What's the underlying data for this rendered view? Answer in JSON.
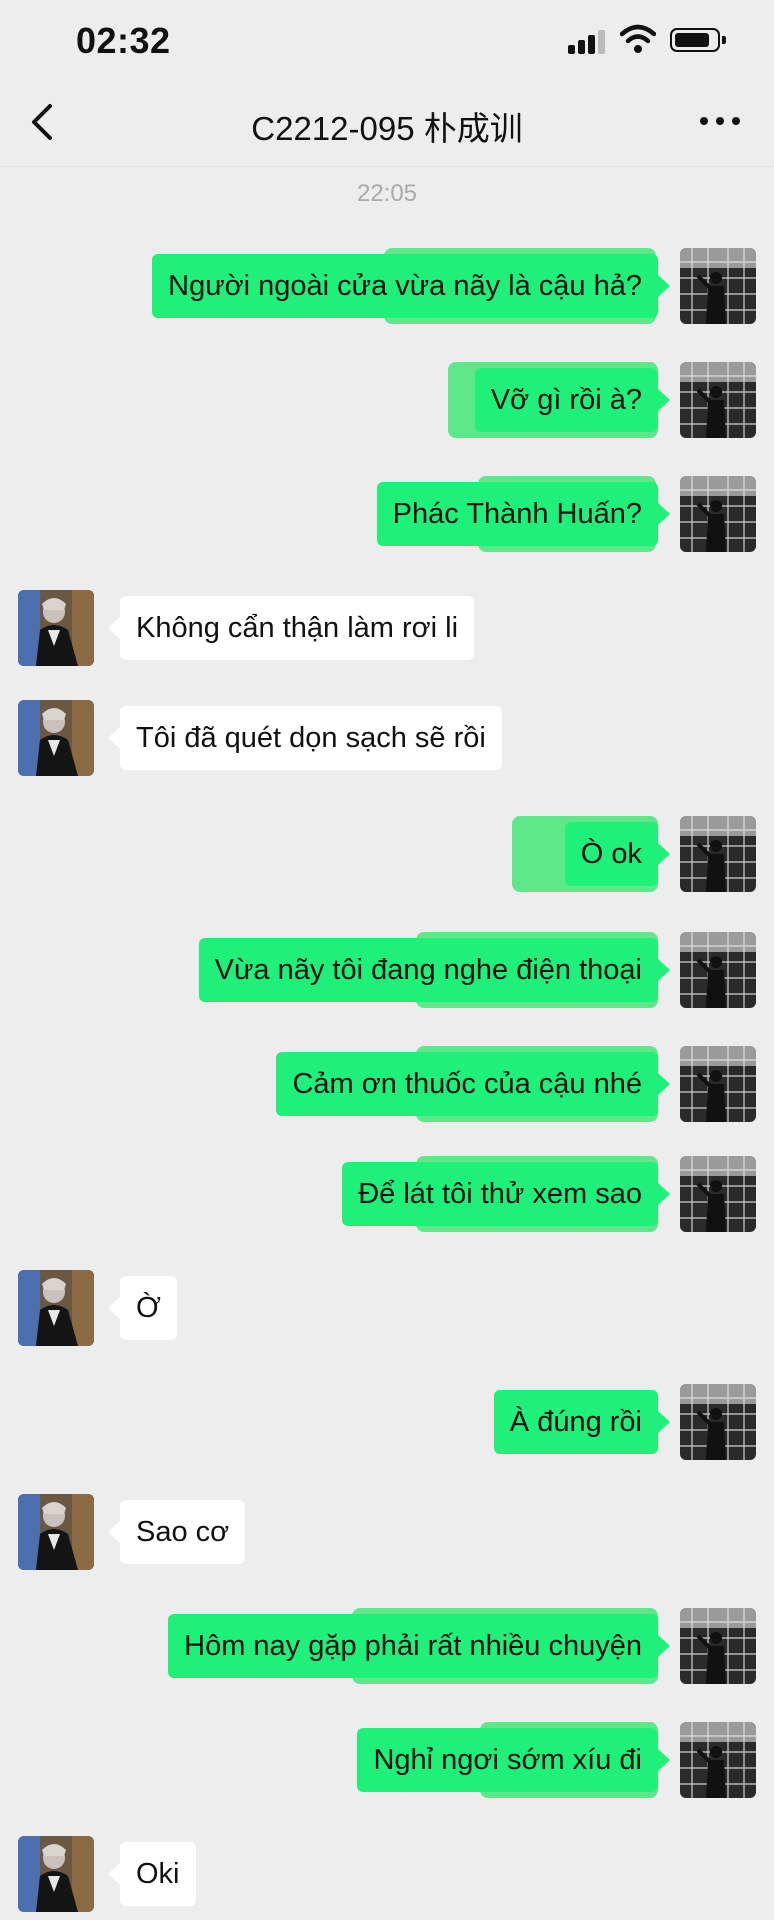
{
  "status_bar": {
    "time": "02:32"
  },
  "nav": {
    "title": "C2212-095 朴成训"
  },
  "timestamp": "22:05",
  "messages": [
    {
      "from": "me",
      "text": "Người ngoài cửa vừa nãy là cậu hả?"
    },
    {
      "from": "me",
      "text": "Vỡ gì rồi à?"
    },
    {
      "from": "me",
      "text": "Phác Thành Huấn?"
    },
    {
      "from": "them",
      "text": "Không cẩn thận làm rơi li"
    },
    {
      "from": "them",
      "text": "Tôi đã quét dọn sạch sẽ rồi"
    },
    {
      "from": "me",
      "text": "Ò ok"
    },
    {
      "from": "me",
      "text": "Vừa nãy tôi đang nghe điện thoại"
    },
    {
      "from": "me",
      "text": "Cảm ơn thuốc của cậu nhé"
    },
    {
      "from": "me",
      "text": "Để lát tôi thử xem sao"
    },
    {
      "from": "them",
      "text": "Ờ"
    },
    {
      "from": "me",
      "text": "À đúng rồi"
    },
    {
      "from": "them",
      "text": "Sao cơ"
    },
    {
      "from": "me",
      "text": "Hôm nay gặp phải rất nhiều chuyện"
    },
    {
      "from": "me",
      "text": "Nghỉ ngơi sớm xíu đi"
    },
    {
      "from": "them",
      "text": "Oki"
    }
  ],
  "colors": {
    "my_bubble": "#1ff07a",
    "their_bubble": "#ffffff",
    "background": "#ededed"
  },
  "icons": {
    "back": "chevron-left-icon",
    "more": "more-dots-icon"
  }
}
